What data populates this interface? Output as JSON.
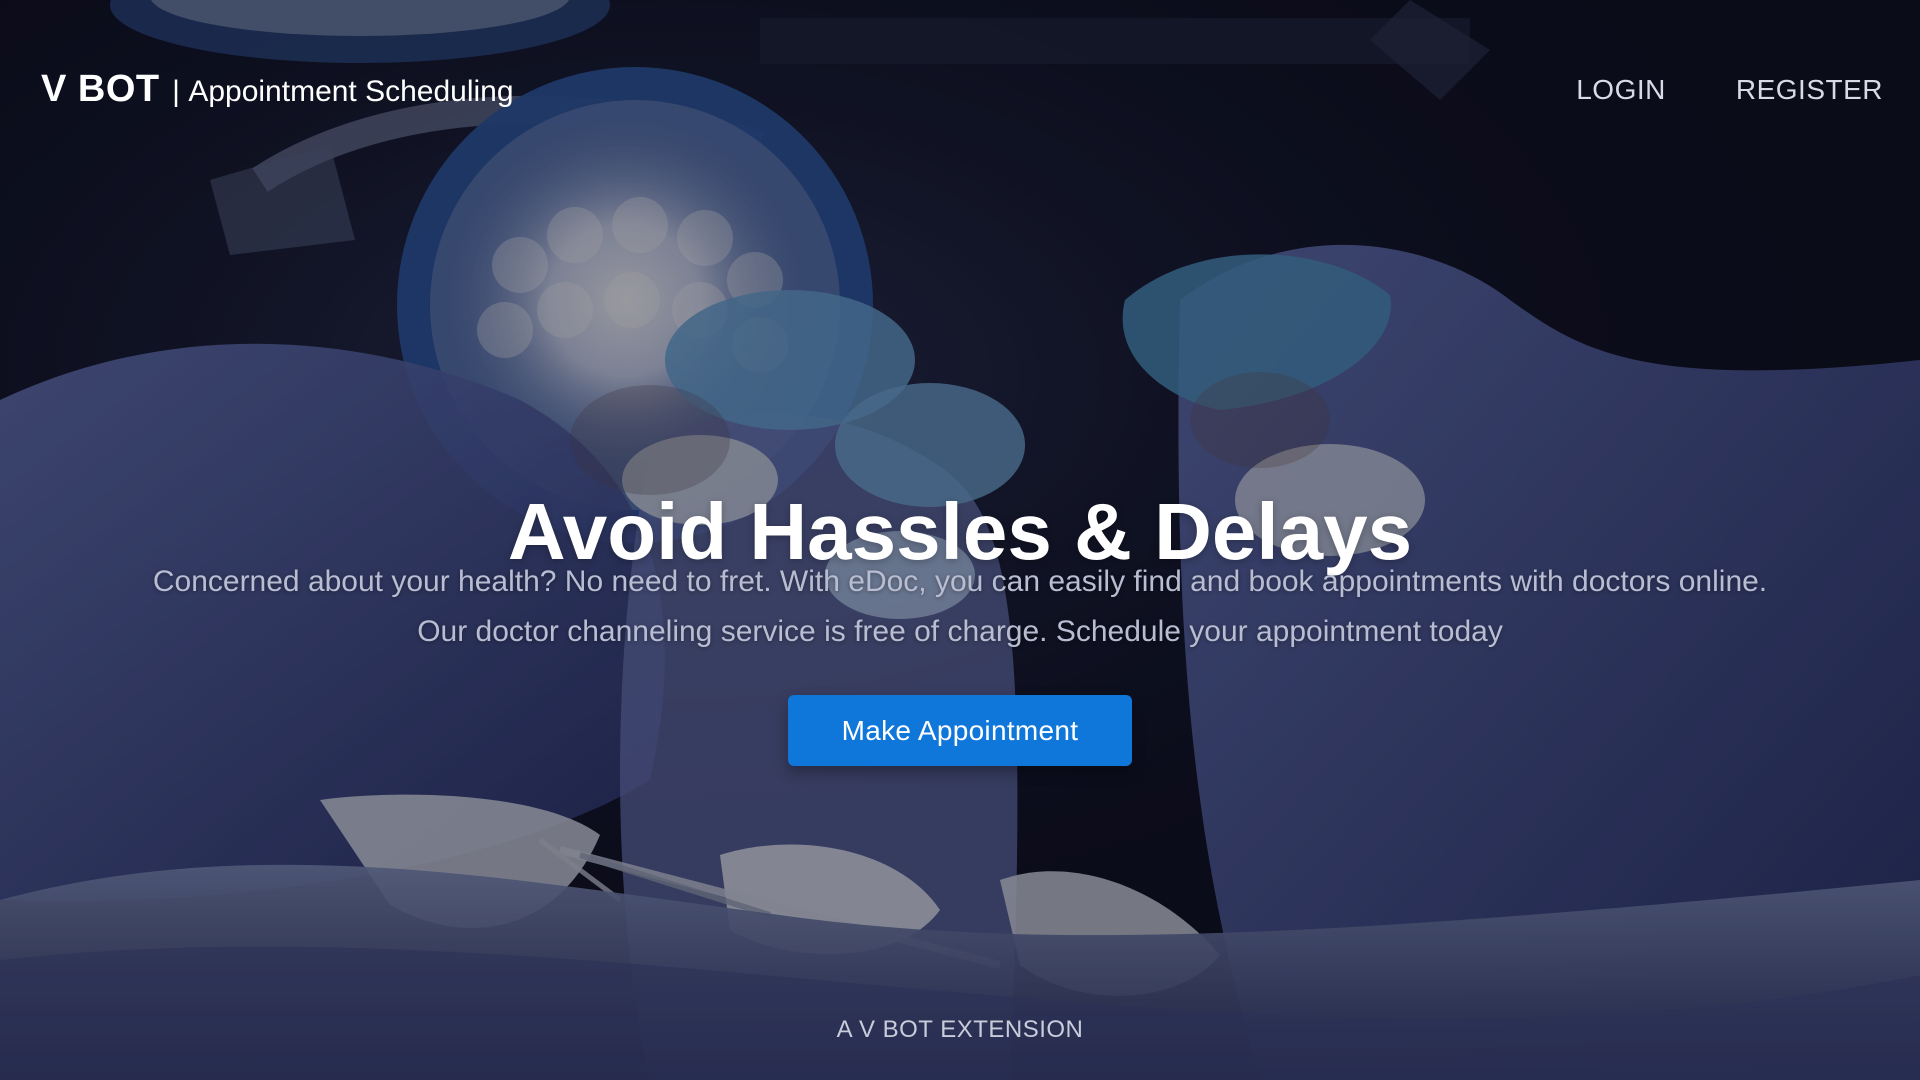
{
  "header": {
    "brand_name": "V BOT",
    "brand_separator": "|",
    "brand_subtitle": "Appointment Scheduling",
    "nav": {
      "login_label": "LOGIN",
      "register_label": "REGISTER"
    }
  },
  "hero": {
    "title": "Avoid Hassles & Delays",
    "description_line_1": "Concerned about your health? No need to fret. With eDoc, you can easily find and book appointments with doctors online.",
    "description_line_2": "Our doctor channeling service is free of charge. Schedule your appointment today",
    "button_label": "Make Appointment"
  },
  "footer": {
    "tagline": "A V BOT EXTENSION"
  },
  "colors": {
    "button": "#0f76da",
    "background_dark": "#0b0d16",
    "scrubs": "#4b5c9a",
    "surgical_cap": "#6aa6d6",
    "light_panel": "#d8dbe8"
  },
  "background_image": {
    "icon": "operating-room-background"
  }
}
